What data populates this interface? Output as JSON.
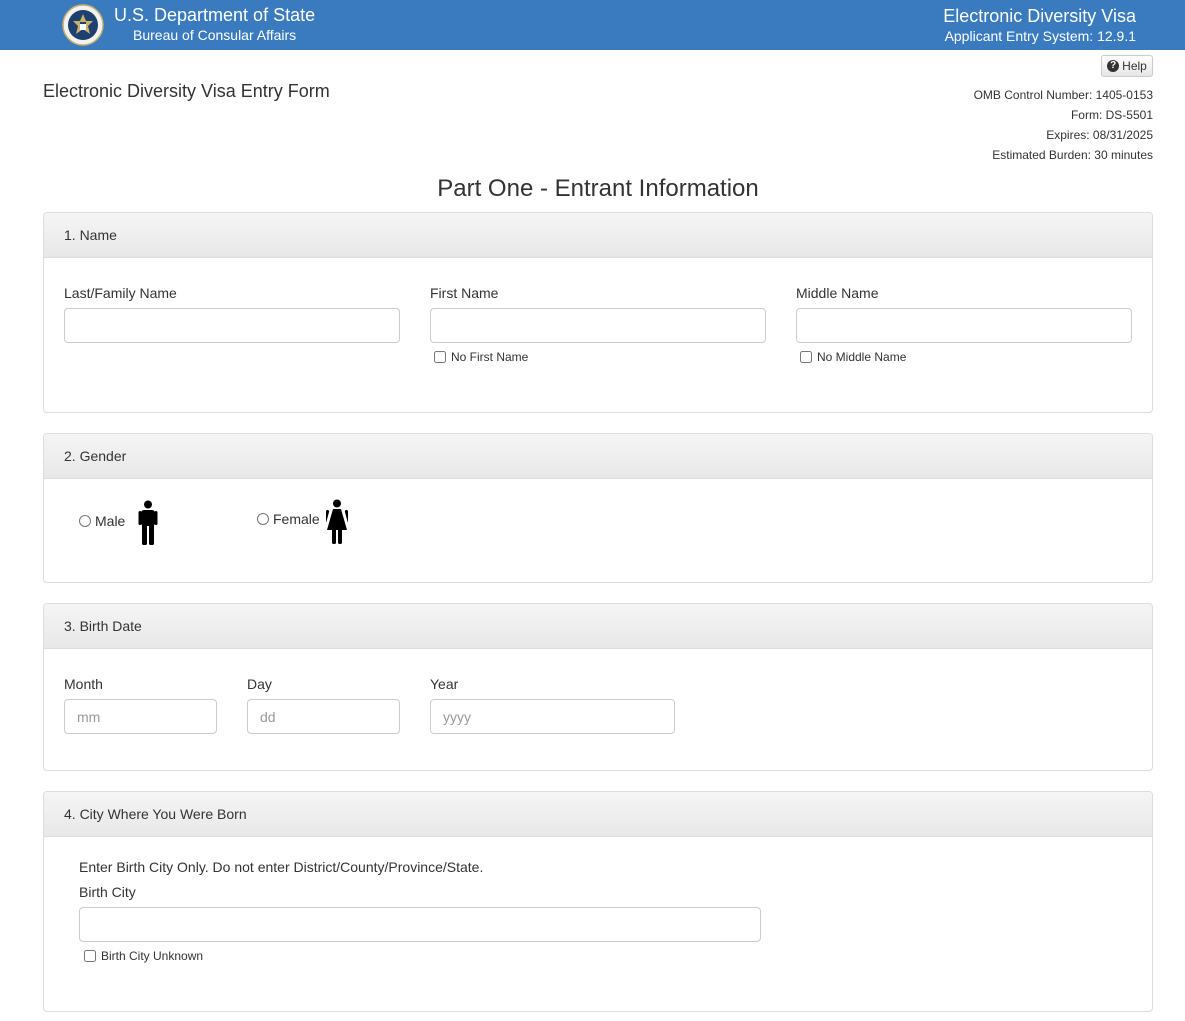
{
  "header": {
    "dept_title": "U.S. Department of State",
    "dept_subtitle": "Bureau of Consular Affairs",
    "system_title": "Electronic Diversity Visa",
    "system_subtitle": "Applicant Entry System: 12.9.1",
    "seal_icon": "state-department-seal-icon"
  },
  "help": {
    "label": "Help",
    "icon": "question-circle-icon"
  },
  "form_title": "Electronic Diversity Visa Entry Form",
  "omb": {
    "control_number": "OMB Control Number: 1405-0153",
    "form": "Form: DS-5501",
    "expires": "Expires: 08/31/2025",
    "burden": "Estimated Burden: 30 minutes"
  },
  "part_title": "Part One - Entrant Information",
  "sections": {
    "name": {
      "title": "1. Name",
      "last_label": "Last/Family Name",
      "last_value": "",
      "first_label": "First Name",
      "first_value": "",
      "middle_label": "Middle Name",
      "middle_value": "",
      "no_first_label": "No First Name",
      "no_middle_label": "No Middle Name"
    },
    "gender": {
      "title": "2. Gender",
      "male_label": "Male",
      "female_label": "Female",
      "male_icon": "male-person-icon",
      "female_icon": "female-person-icon"
    },
    "birth_date": {
      "title": "3. Birth Date",
      "month_label": "Month",
      "month_placeholder": "mm",
      "day_label": "Day",
      "day_placeholder": "dd",
      "year_label": "Year",
      "year_placeholder": "yyyy"
    },
    "birth_city": {
      "title": "4. City Where You Were Born",
      "instruction": "Enter Birth City Only. Do not enter District/County/Province/State.",
      "city_label": "Birth City",
      "city_value": "",
      "unknown_label": "Birth City Unknown"
    }
  },
  "colors": {
    "header_bg": "#3a7bbf",
    "panel_head_bg": "#eeeeee",
    "border": "#dddddd"
  }
}
